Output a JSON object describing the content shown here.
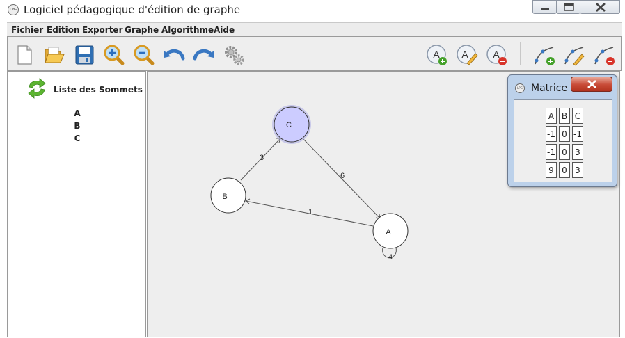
{
  "window": {
    "title": "Logiciel pédagogique d'édition de graphe",
    "icon_label": "LPG"
  },
  "menu": [
    "Fichier",
    "Edition",
    "Exporter",
    "Graphe",
    "Algorithme",
    "Aide"
  ],
  "toolbar": {
    "left": [
      "new-file",
      "open-folder",
      "save",
      "zoom-in",
      "zoom-out",
      "undo",
      "redo",
      "settings"
    ],
    "right": [
      "add-vertex",
      "edit-vertex",
      "delete-vertex",
      "add-edge",
      "edit-edge",
      "delete-edge"
    ],
    "vertex_letter": "A"
  },
  "sidebar": {
    "title": "Liste des Sommets",
    "vertices": [
      "A",
      "B",
      "C"
    ]
  },
  "graph": {
    "nodes": [
      {
        "id": "C",
        "label": "C",
        "selected": true
      },
      {
        "id": "B",
        "label": "B",
        "selected": false
      },
      {
        "id": "A",
        "label": "A",
        "selected": false
      }
    ],
    "edges": [
      {
        "from": "B",
        "to": "C",
        "weight": "3"
      },
      {
        "from": "C",
        "to": "A",
        "weight": "6"
      },
      {
        "from": "A",
        "to": "B",
        "weight": "1"
      },
      {
        "from": "A",
        "to": "A",
        "weight": "4"
      }
    ],
    "colors": {
      "selected_fill": "#ccccff",
      "selected_ring": "#a9a9e6",
      "node_fill": "#ffffff"
    }
  },
  "matrix_dialog": {
    "title": "Matrice",
    "icon_label": "LPG",
    "rows": [
      [
        "A",
        "B",
        "C"
      ],
      [
        "-1",
        "0",
        "-1"
      ],
      [
        "-1",
        "0",
        "3"
      ],
      [
        "9",
        "0",
        "3"
      ]
    ]
  }
}
